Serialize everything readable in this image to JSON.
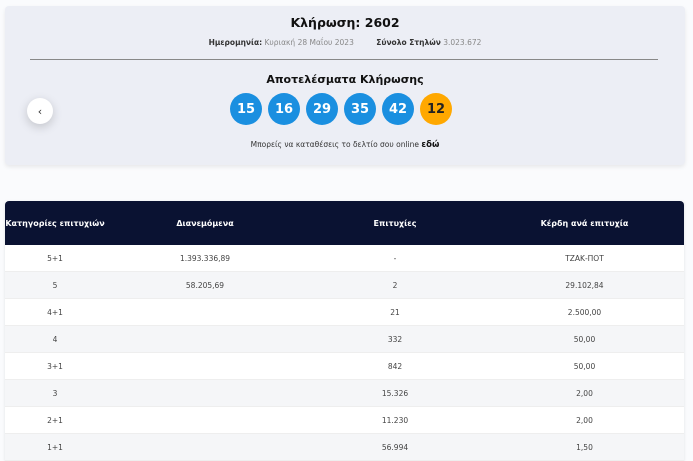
{
  "draw": {
    "title": "Κλήρωση: 2602",
    "date_label": "Ημερομηνία:",
    "date_value": "Κυριακή 28 Μαΐου 2023",
    "columns_label": "Σύνολο Στηλών",
    "columns_value": "3.023.672"
  },
  "results": {
    "title": "Αποτελέσματα Κλήρωσης",
    "numbers": [
      "15",
      "16",
      "29",
      "35",
      "42"
    ],
    "bonus": "12",
    "online_text": "Μπορείς να καταθέσεις το δελτίο σου online",
    "online_link": "εδώ",
    "prev_icon": "‹"
  },
  "colors": {
    "ball": "#1a8fe0",
    "bonus": "#ffa800",
    "header": "#0a1232"
  },
  "table": {
    "headers": [
      "Κατηγορίες επιτυχιών",
      "Διανεμόμενα",
      "Επιτυχίες",
      "Κέρδη ανά επιτυχία"
    ],
    "rows": [
      [
        "5+1",
        "1.393.336,89",
        "-",
        "ΤΖΑΚ-ΠΟΤ"
      ],
      [
        "5",
        "58.205,69",
        "2",
        "29.102,84"
      ],
      [
        "4+1",
        "",
        "21",
        "2.500,00"
      ],
      [
        "4",
        "",
        "332",
        "50,00"
      ],
      [
        "3+1",
        "",
        "842",
        "50,00"
      ],
      [
        "3",
        "",
        "15.326",
        "2,00"
      ],
      [
        "2+1",
        "",
        "11.230",
        "2,00"
      ],
      [
        "1+1",
        "",
        "56.994",
        "1,50"
      ]
    ]
  }
}
